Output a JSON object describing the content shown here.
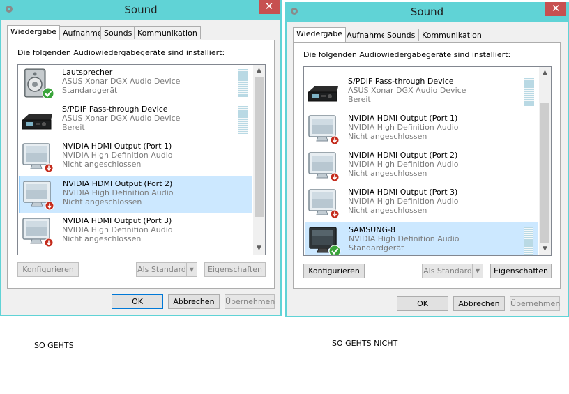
{
  "dialogs": [
    {
      "title": "Sound",
      "close": "✕",
      "tabs": [
        "Wiedergabe",
        "Aufnahme",
        "Sounds",
        "Kommunikation"
      ],
      "intro": "Die folgenden Audiowiedergabegeräte sind installiert:",
      "devices": [
        {
          "name": "Lautsprecher",
          "driver": "ASUS Xonar DGX Audio Device",
          "status": "Standardgerät",
          "icon": "speaker-default-icon"
        },
        {
          "name": "S/PDIF Pass-through Device",
          "driver": "ASUS Xonar DGX Audio Device",
          "status": "Bereit",
          "icon": "spdif-receiver-icon"
        },
        {
          "name": "NVIDIA HDMI Output (Port 1)",
          "driver": "NVIDIA High Definition Audio",
          "status": "Nicht angeschlossen",
          "icon": "monitor-disconnected-icon"
        },
        {
          "name": "NVIDIA HDMI Output (Port 2)",
          "driver": "NVIDIA High Definition Audio",
          "status": "Nicht angeschlossen",
          "icon": "monitor-disconnected-icon"
        },
        {
          "name": "NVIDIA HDMI Output (Port 3)",
          "driver": "NVIDIA High Definition Audio",
          "status": "Nicht angeschlossen",
          "icon": "monitor-disconnected-icon"
        }
      ],
      "buttons": {
        "configure": "Konfigurieren",
        "set_default": "Als Standard",
        "properties": "Eigenschaften",
        "ok": "OK",
        "cancel": "Abbrechen",
        "apply": "Übernehmen"
      },
      "caption": "SO GEHTS"
    },
    {
      "title": "Sound",
      "close": "✕",
      "tabs": [
        "Wiedergabe",
        "Aufnahme",
        "Sounds",
        "Kommunikation"
      ],
      "intro": "Die folgenden Audiowiedergabegeräte sind installiert:",
      "devices": [
        {
          "name": "S/PDIF Pass-through Device",
          "driver": "ASUS Xonar DGX Audio Device",
          "status": "Bereit",
          "icon": "spdif-receiver-icon"
        },
        {
          "name": "NVIDIA HDMI Output (Port 1)",
          "driver": "NVIDIA High Definition Audio",
          "status": "Nicht angeschlossen",
          "icon": "monitor-disconnected-icon"
        },
        {
          "name": "NVIDIA HDMI Output (Port 2)",
          "driver": "NVIDIA High Definition Audio",
          "status": "Nicht angeschlossen",
          "icon": "monitor-disconnected-icon"
        },
        {
          "name": "NVIDIA HDMI Output (Port 3)",
          "driver": "NVIDIA High Definition Audio",
          "status": "Nicht angeschlossen",
          "icon": "monitor-disconnected-icon"
        },
        {
          "name": "SAMSUNG-8",
          "driver": "NVIDIA High Definition Audio",
          "status": "Standardgerät",
          "icon": "monitor-default-icon"
        }
      ],
      "buttons": {
        "configure": "Konfigurieren",
        "set_default": "Als Standard",
        "properties": "Eigenschaften",
        "ok": "OK",
        "cancel": "Abbrechen",
        "apply": "Übernehmen"
      },
      "caption": "SO GEHTS NICHT"
    }
  ],
  "colors": {
    "title_bar": "#60d3d6",
    "close_button": "#c75050",
    "selection": "#cce8ff",
    "check_green": "#3aa43a",
    "disconnect_red": "#c42b1c"
  }
}
